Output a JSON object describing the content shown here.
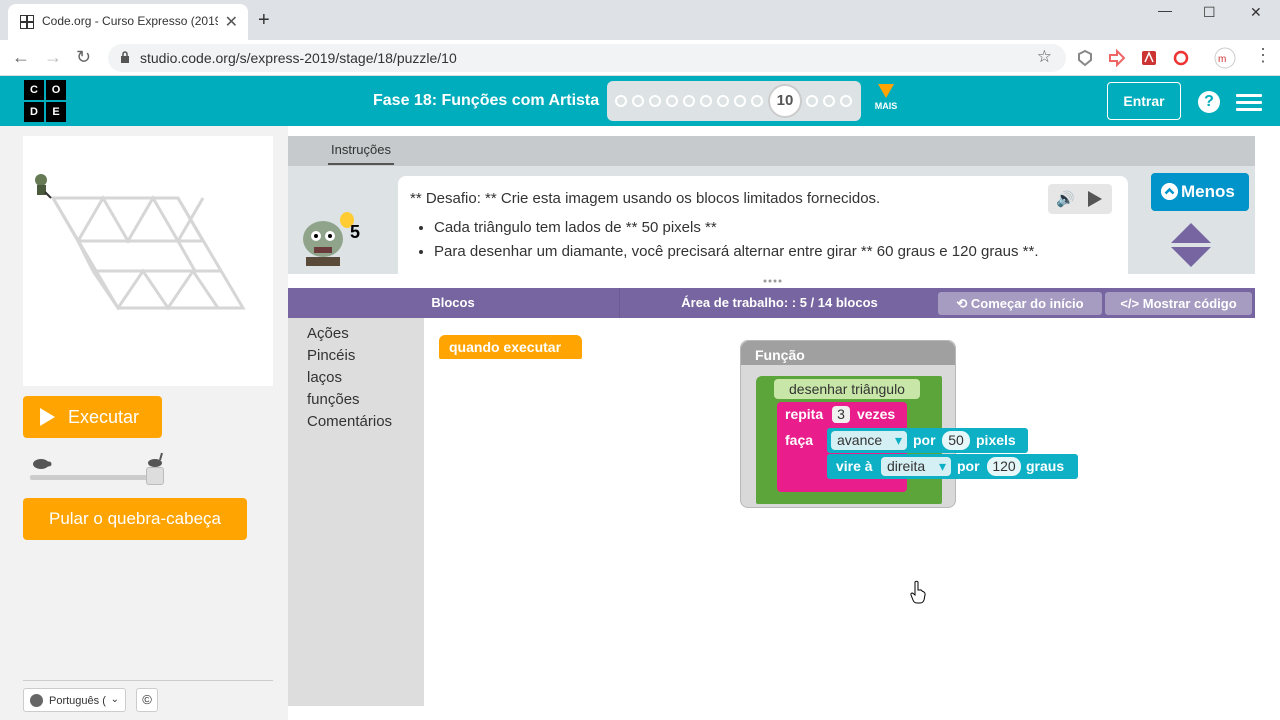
{
  "browser": {
    "tab_title": "Code.org - Curso Expresso (2019",
    "close_tab": "✕",
    "new_tab": "+",
    "url": "studio.code.org/s/express-2019/stage/18/puzzle/10",
    "minimize": "—",
    "maximize": "☐",
    "close_window": "✕"
  },
  "header": {
    "logo_letters": [
      "C",
      "O",
      "D",
      "E"
    ],
    "stage_title": "Fase 18: Funções com Artista",
    "current_puzzle": "10",
    "more_label": "MAIS",
    "signin_label": "Entrar",
    "help_label": "?"
  },
  "left": {
    "run_label": "Executar",
    "skip_label": "Pular o quebra-cabeça",
    "language": "Português (",
    "copyright": "©"
  },
  "instructions": {
    "tab_label": "Instruções",
    "hint_count": "5",
    "line1": "** Desafio: ** Crie esta imagem usando os blocos limitados fornecidos.",
    "bullets": [
      "Cada triângulo tem lados de ** 50 pixels **",
      "Para desenhar um diamante, você precisará alternar entre girar ** 60 graus e 120 graus **."
    ],
    "less_label": "Menos"
  },
  "workspace": {
    "blocks_label": "Blocos",
    "title": "Área de trabalho: : 5 / 14 blocos",
    "restart_label": "Começar do início",
    "show_code_label": "Mostrar código",
    "toolbox": [
      "Ações",
      "Pincéis",
      "laços",
      "funções",
      "Comentários"
    ],
    "when_run": "quando executar",
    "function_label": "Função",
    "function_name": "desenhar triângulo",
    "repeat_word": "repita",
    "repeat_count": "3",
    "times_word": "vezes",
    "do_word": "faça",
    "forward_dropdown": "avance",
    "by_word": "por",
    "forward_value": "50",
    "pixels_word": "pixels",
    "turn_word": "vire à",
    "turn_dropdown": "direita",
    "turn_by_word": "por",
    "turn_value": "120",
    "degrees_word": "graus"
  },
  "colors": {
    "header": "#00adbc",
    "orange": "#ffa400",
    "purple": "#7665a0",
    "function_green": "#5ba53a",
    "loop_pink": "#e91e8c",
    "action_teal": "#0eb0c6",
    "menos_blue": "#0094ca"
  }
}
